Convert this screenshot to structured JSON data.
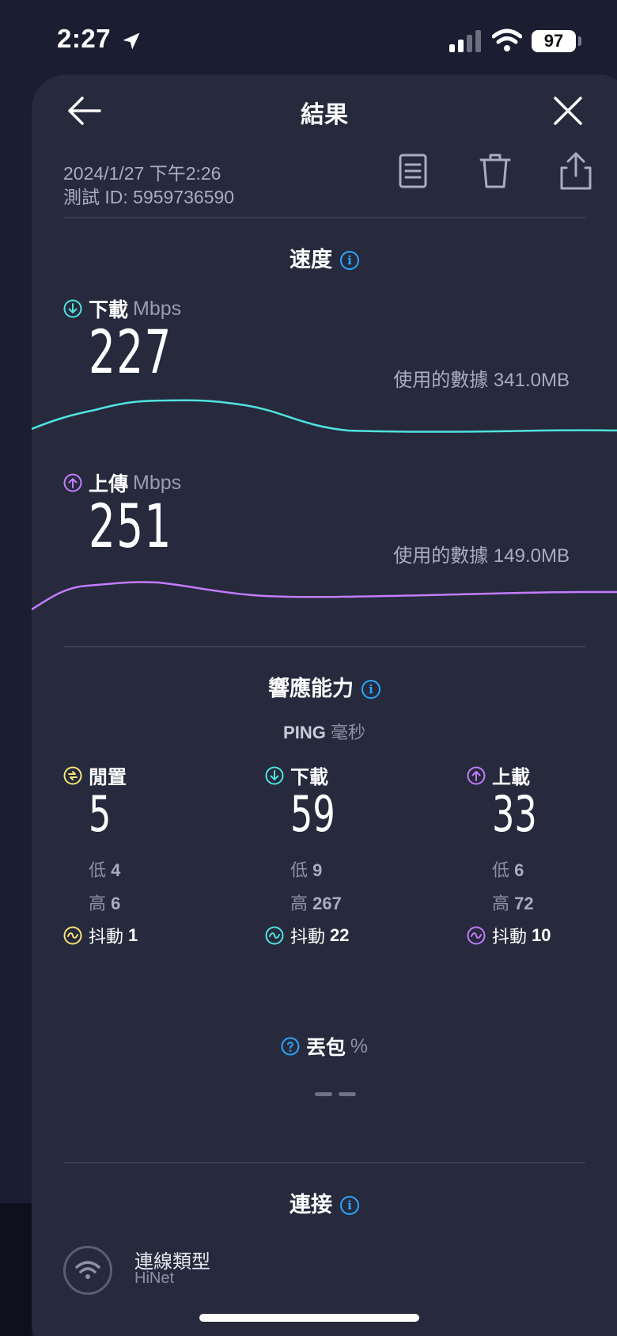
{
  "status_bar": {
    "time": "2:27",
    "battery": "97"
  },
  "header": {
    "title": "結果"
  },
  "meta": {
    "date": "2024/1/27 下午2:26",
    "test_id": "測試 ID: 5959736590"
  },
  "speed": {
    "section_title": "速度",
    "download": {
      "label": "下載",
      "unit": "Mbps",
      "value": "227",
      "data_used": "使用的數據 341.0MB"
    },
    "upload": {
      "label": "上傳",
      "unit": "Mbps",
      "value": "251",
      "data_used": "使用的數據 149.0MB"
    }
  },
  "responsiveness": {
    "section_title": "響應能力",
    "ping_label": "PING",
    "ping_unit": "毫秒",
    "columns": [
      {
        "label": "閒置",
        "value": "5",
        "low_label": "低",
        "low": "4",
        "high_label": "高",
        "high": "6",
        "jitter_label": "抖動",
        "jitter": "1",
        "color": "#f4e27a"
      },
      {
        "label": "下載",
        "value": "59",
        "low_label": "低",
        "low": "9",
        "high_label": "高",
        "high": "267",
        "jitter_label": "抖動",
        "jitter": "22",
        "color": "#4fe3e0"
      },
      {
        "label": "上載",
        "value": "33",
        "low_label": "低",
        "low": "6",
        "high_label": "高",
        "high": "72",
        "jitter_label": "抖動",
        "jitter": "10",
        "color": "#c47cff"
      }
    ]
  },
  "packet_loss": {
    "label": "丟包",
    "unit": "%"
  },
  "connection": {
    "section_title": "連接",
    "type_label": "連線類型",
    "type_value": "HiNet"
  },
  "colors": {
    "download": "#4fe3e0",
    "upload": "#c47cff",
    "info": "#2aa7ff",
    "background": "#262a3c"
  }
}
